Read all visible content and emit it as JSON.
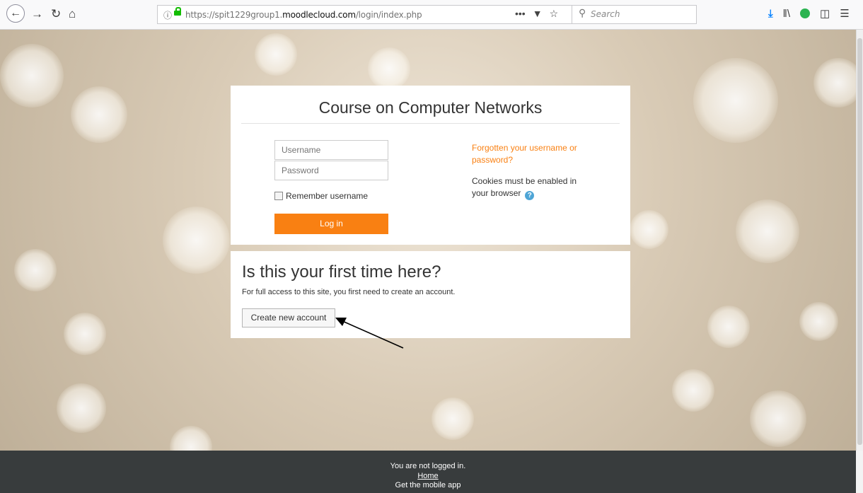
{
  "browser": {
    "url_prefix": "https://spit1229group1.",
    "url_domain": "moodlecloud.com",
    "url_path": "/login/index.php",
    "url_more": "•••",
    "search_placeholder": "Search"
  },
  "login": {
    "title": "Course on Computer Networks",
    "username_placeholder": "Username",
    "password_placeholder": "Password",
    "remember_label": "Remember username",
    "login_button": "Log in",
    "forgot_link": "Forgotten your username or password?",
    "cookies_text": "Cookies must be enabled in your browser"
  },
  "signup": {
    "title": "Is this your first time here?",
    "text": "For full access to this site, you first need to create an account.",
    "create_button": "Create new account"
  },
  "footer": {
    "status": "You are not logged in.",
    "home_link": "Home",
    "mobile_app": "Get the mobile app"
  },
  "colors": {
    "accent": "#f98012",
    "footer_bg": "#383c3d"
  },
  "icons": [
    "back-icon",
    "forward-icon",
    "reload-icon",
    "home-icon",
    "info-icon",
    "lock-icon",
    "pocket-icon",
    "bookmark-star-icon",
    "search-icon",
    "download-icon",
    "library-icon",
    "extension-icon",
    "sidebar-icon",
    "menu-icon",
    "help-icon",
    "arrow-annotation"
  ]
}
